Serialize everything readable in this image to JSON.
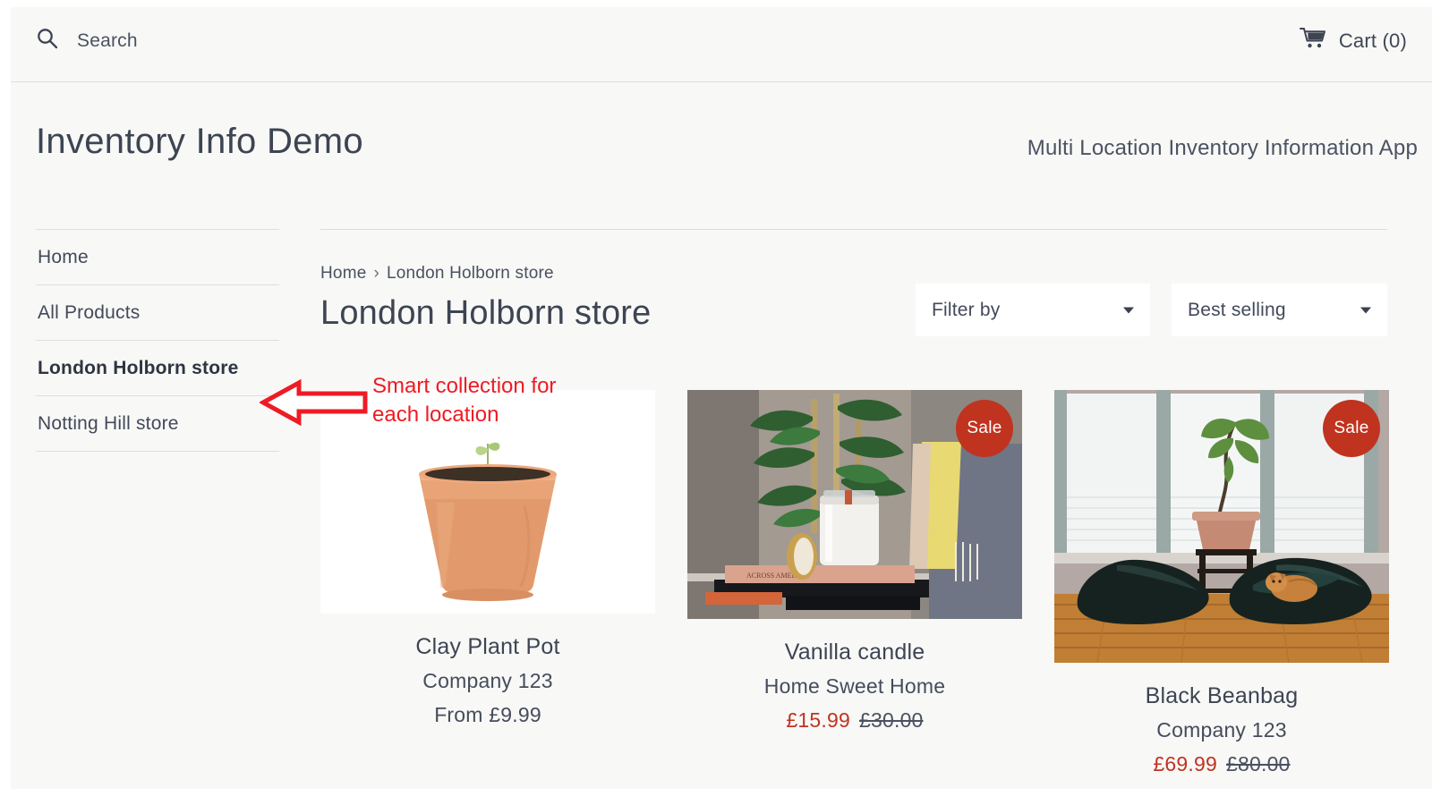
{
  "topbar": {
    "search_icon": "search-icon",
    "search_placeholder": "Search",
    "cart_icon": "shopping-cart-icon",
    "cart_label": "Cart (0)"
  },
  "masthead": {
    "brand_title": "Inventory Info Demo",
    "tagline": "Multi Location Inventory Information App"
  },
  "sidebar": {
    "items": [
      {
        "label": "Home",
        "active": false
      },
      {
        "label": "All Products",
        "active": false
      },
      {
        "label": "London Holborn store",
        "active": true
      },
      {
        "label": "Notting Hill store",
        "active": false
      }
    ]
  },
  "breadcrumb": {
    "home": "Home",
    "separator": "›",
    "current": "London Holborn store"
  },
  "collection": {
    "title": "London Holborn store"
  },
  "filters": {
    "filter_by": {
      "value": "Filter by",
      "caret_icon": "chevron-down-icon"
    },
    "sort_by": {
      "value": "Best selling",
      "caret_icon": "chevron-down-icon"
    }
  },
  "annotation": {
    "text": "Smart collection for\neach location",
    "color": "#ee1b24",
    "arrow_icon": "left-arrow-annotation-icon"
  },
  "products": [
    {
      "title": "Clay Plant Pot",
      "vendor": "Company 123",
      "price_prefix": "From ",
      "price": "£9.99",
      "compare_at": "",
      "on_sale": false,
      "sale_badge": "",
      "image_alt": "terracotta clay plant pot with seedling"
    },
    {
      "title": "Vanilla candle",
      "vendor": "Home Sweet Home",
      "price_prefix": "",
      "price": "£15.99",
      "compare_at": "£30.00",
      "on_sale": true,
      "sale_badge": "Sale",
      "image_alt": "white candle jar on books beside a plant"
    },
    {
      "title": "Black Beanbag",
      "vendor": "Company 123",
      "price_prefix": "",
      "price": "£69.99",
      "compare_at": "£80.00",
      "on_sale": true,
      "sale_badge": "Sale",
      "image_alt": "two dark beanbags by windows with a cat and plant"
    }
  ],
  "colors": {
    "page_background": "#f8f8f7",
    "text": "#3d4452",
    "sale_red": "#c0331f",
    "annotation_red": "#ee1b24",
    "rule": "#e0dedb"
  }
}
